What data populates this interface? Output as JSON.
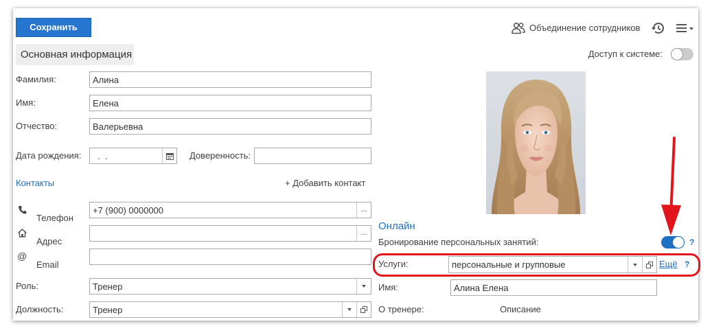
{
  "toolbar": {
    "save_label": "Сохранить",
    "merge_employees_label": "Объединение сотрудников",
    "merge_icon": "people-icon",
    "history_icon": "history-icon",
    "menu_icon": "hamburger-menu-icon"
  },
  "main_section": {
    "title": "Основная информация"
  },
  "system_access": {
    "label": "Доступ к системе:",
    "enabled": false
  },
  "fields": {
    "last_name": {
      "label": "Фамилия:",
      "value": "Алина"
    },
    "first_name": {
      "label": "Имя:",
      "value": "Елена"
    },
    "patronymic": {
      "label": "Отчество:",
      "value": "Валерьевна"
    },
    "birth_date": {
      "label": "Дата рождения:",
      "value": "  .  .",
      "icon": "calendar-icon"
    },
    "power_of_attorney": {
      "label": "Доверенность:",
      "value": ""
    }
  },
  "contacts": {
    "title": "Контакты",
    "add_label": "+ Добавить контакт",
    "ellipsis_label": "...",
    "items": [
      {
        "label": "Телефон",
        "value": "+7 (900) 0000000",
        "icon": "phone-icon"
      },
      {
        "label": "Адрес",
        "value": "",
        "icon": "home-icon"
      },
      {
        "label": "Email",
        "value": "",
        "icon": "at-icon",
        "icon_glyph": "@"
      }
    ]
  },
  "role": {
    "label": "Роль:",
    "value": "Тренер"
  },
  "position": {
    "label": "Должность:",
    "value": "Тренер"
  },
  "online": {
    "title": "Онлайн",
    "booking": {
      "label": "Бронирование персональных занятий:",
      "enabled": true,
      "help": "?"
    },
    "services": {
      "label": "Услуги:",
      "value": "персональные и групповые",
      "more": "Ещё",
      "help": "?"
    },
    "name": {
      "label": "Имя:",
      "value": "Алина Елена"
    },
    "about": {
      "label": "О тренере:",
      "value": "Описание"
    }
  },
  "colors": {
    "accent": "#2676cf",
    "link": "#1f6fc5",
    "annotation_red": "#e3151c",
    "section_bg": "#eeeeee"
  }
}
